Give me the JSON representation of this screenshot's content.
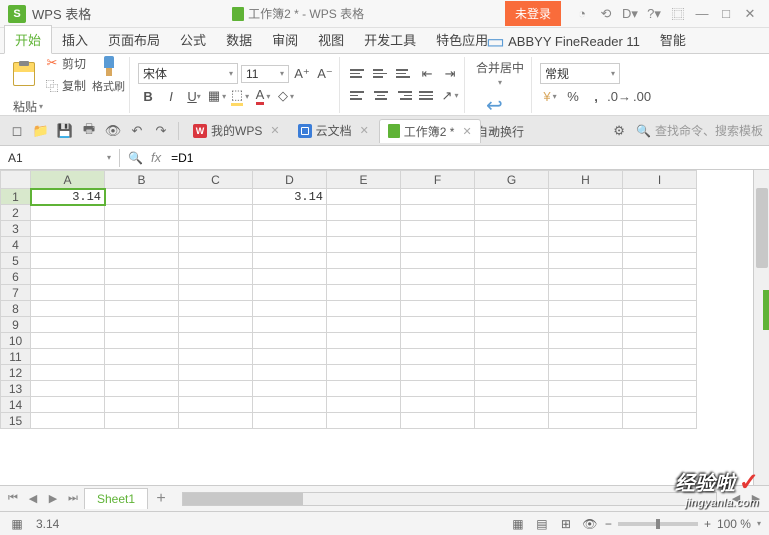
{
  "app": {
    "badge": "S",
    "name": "WPS 表格",
    "doc_title": "工作簿2 * - WPS 表格",
    "login": "未登录"
  },
  "menu": {
    "items": [
      "开始",
      "插入",
      "页面布局",
      "公式",
      "数据",
      "审阅",
      "视图",
      "开发工具",
      "特色应用",
      "ABBYY FineReader 11",
      "智能"
    ],
    "active_index": 0
  },
  "ribbon": {
    "paste": "粘贴",
    "cut": "剪切",
    "copy": "复制",
    "format_painter": "格式刷",
    "font_name": "宋体",
    "font_size": "11",
    "merge": "合并居中",
    "wrap": "自动换行",
    "number_format": "常规"
  },
  "doctabs": {
    "items": [
      {
        "label": "我的WPS",
        "type": "w"
      },
      {
        "label": "云文档",
        "type": "c"
      },
      {
        "label": "工作簿2 *",
        "type": "s"
      }
    ],
    "active_index": 2,
    "search_placeholder": "查找命令、搜索模板"
  },
  "formula": {
    "cell_ref": "A1",
    "fx": "fx",
    "value": "=D1"
  },
  "grid": {
    "columns": [
      "A",
      "B",
      "C",
      "D",
      "E",
      "F",
      "G",
      "H",
      "I"
    ],
    "rows": [
      1,
      2,
      3,
      4,
      5,
      6,
      7,
      8,
      9,
      10,
      11,
      12,
      13,
      14,
      15
    ],
    "active_row": 1,
    "active_col": "A",
    "cells": {
      "A1": "3.14",
      "D1": "3.14"
    }
  },
  "sheets": {
    "active": "Sheet1"
  },
  "status": {
    "value": "3.14",
    "zoom": "100 %"
  },
  "watermark": {
    "main": "经验啦",
    "sub": "jingyanla.com"
  },
  "chart_data": null
}
